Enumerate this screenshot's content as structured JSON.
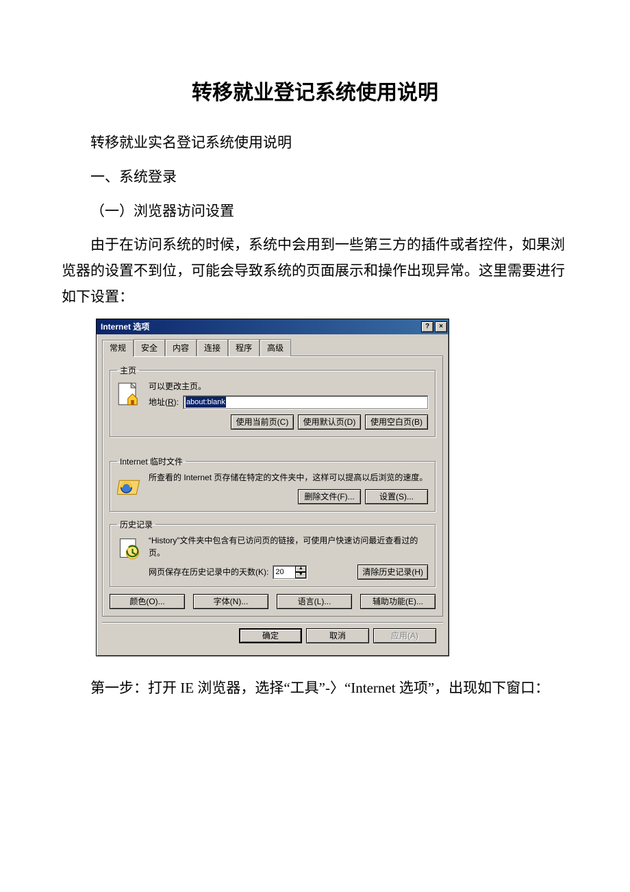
{
  "doc": {
    "title": "转移就业登记系统使用说明",
    "p1": "转移就业实名登记系统使用说明",
    "p2": "一、系统登录",
    "p3": "（一）浏览器访问设置",
    "p4": "由于在访问系统的时候，系统中会用到一些第三方的插件或者控件，如果浏览器的设置不到位，可能会导致系统的页面展示和操作出现异常。这里需要进行如下设置：",
    "p5": "第一步：打开 IE 浏览器，选择“工具”-〉“Internet 选项”，出现如下窗口："
  },
  "dialog": {
    "title": "Internet 选项",
    "help_btn": "?",
    "close_btn": "×",
    "tabs": [
      "常规",
      "安全",
      "内容",
      "连接",
      "程序",
      "高级"
    ],
    "homepage": {
      "legend": "主页",
      "desc": "可以更改主页。",
      "addr_label_pre": "地址(",
      "addr_label_key": "R",
      "addr_label_post": "):",
      "addr_value": "about:blank",
      "btn_current": "使用当前页(C)",
      "btn_default": "使用默认页(D)",
      "btn_blank": "使用空白页(B)"
    },
    "temp": {
      "legend": "Internet 临时文件",
      "desc": "所查看的 Internet 页存储在特定的文件夹中，这样可以提高以后浏览的速度。",
      "btn_delete": "删除文件(F)...",
      "btn_settings": "设置(S)..."
    },
    "history": {
      "legend": "历史记录",
      "desc": "“History”文件夹中包含有已访问页的链接，可使用户快速访问最近查看过的页。",
      "days_label": "网页保存在历史记录中的天数(K):",
      "days_value": "20",
      "btn_clear": "清除历史记录(H)"
    },
    "bottom4": {
      "colors": "颜色(O)...",
      "fonts": "字体(N)...",
      "lang": "语言(L)...",
      "access": "辅助功能(E)..."
    },
    "footer": {
      "ok": "确定",
      "cancel": "取消",
      "apply": "应用(A)"
    }
  }
}
